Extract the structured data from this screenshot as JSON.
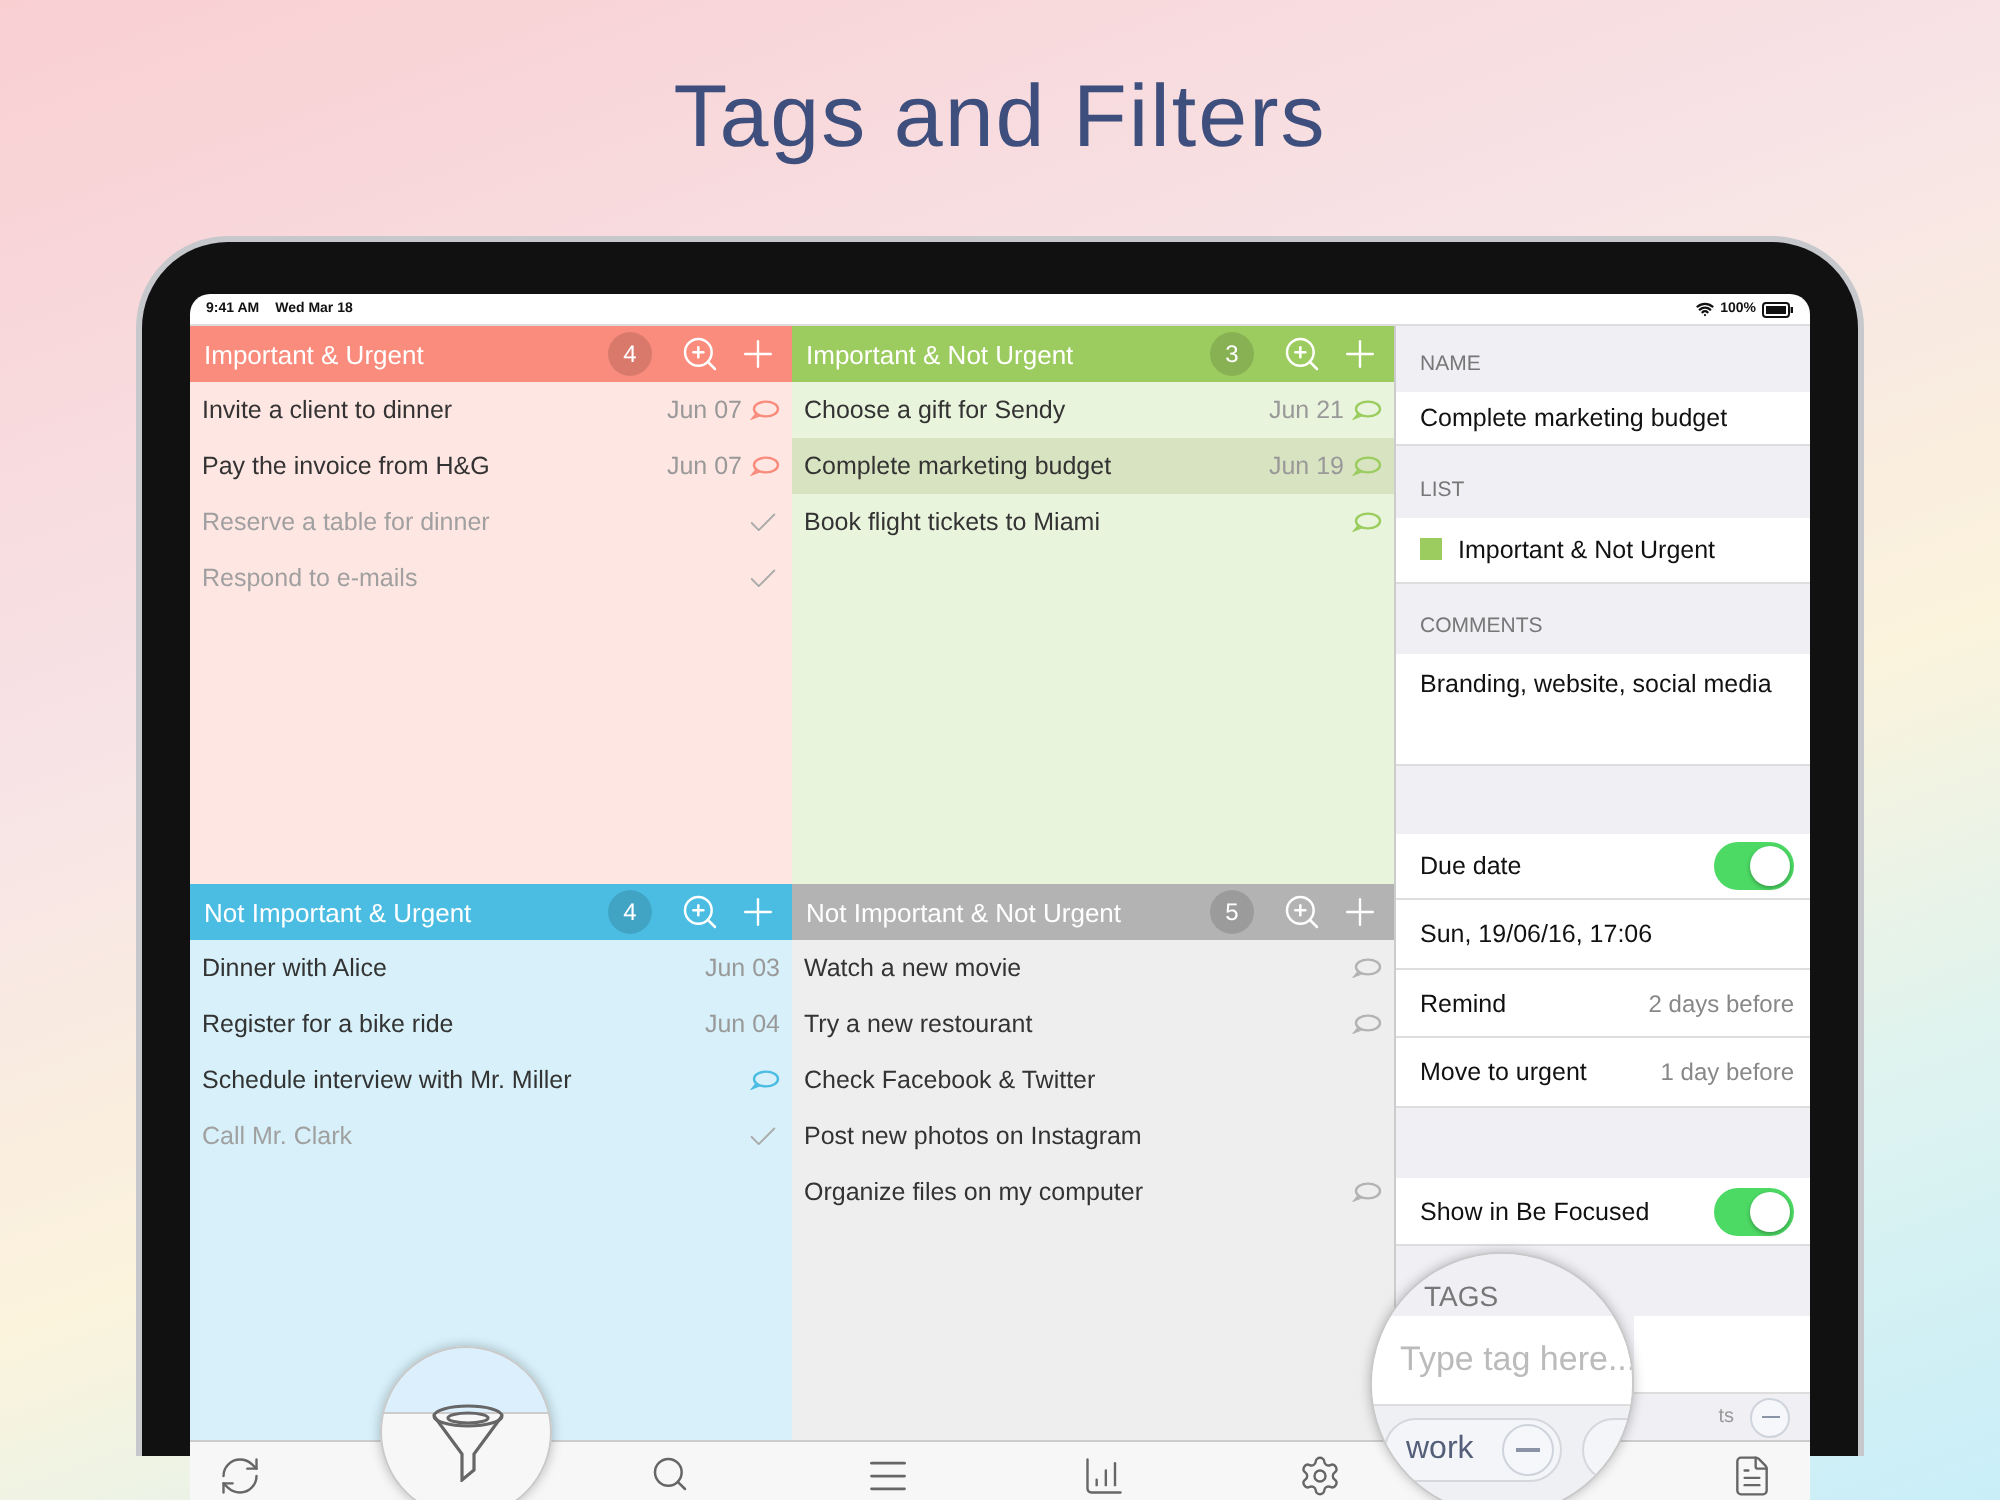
{
  "headline": "Tags and Filters",
  "status_bar": {
    "time": "9:41 AM",
    "date": "Wed Mar 18",
    "battery": "100%"
  },
  "quadrants": [
    {
      "title": "Important & Urgent",
      "count": "4",
      "color": "#fa8c7d",
      "tasks": [
        {
          "title": "Invite a client to dinner",
          "date": "Jun 07",
          "comment": true,
          "done": false,
          "selected": false
        },
        {
          "title": "Pay the invoice from H&G",
          "date": "Jun 07",
          "comment": true,
          "done": false,
          "selected": false
        },
        {
          "title": "Reserve a table for dinner",
          "comment": false,
          "done": true,
          "selected": false
        },
        {
          "title": "Respond to e-mails",
          "comment": false,
          "done": true,
          "selected": false
        }
      ]
    },
    {
      "title": "Important & Not Urgent",
      "count": "3",
      "color": "#9ccc5f",
      "tasks": [
        {
          "title": "Choose a gift for Sendy",
          "date": "Jun 21",
          "comment": true,
          "done": false,
          "selected": false
        },
        {
          "title": "Complete marketing budget",
          "date": "Jun 19",
          "comment": true,
          "done": false,
          "selected": true
        },
        {
          "title": "Book flight tickets to Miami",
          "comment": true,
          "done": false,
          "selected": false
        }
      ]
    },
    {
      "title": "Not Important & Urgent",
      "count": "4",
      "color": "#4bbde3",
      "tasks": [
        {
          "title": "Dinner with Alice",
          "date": "Jun 03",
          "comment": false,
          "done": false,
          "selected": false
        },
        {
          "title": "Register for a bike ride",
          "date": "Jun 04",
          "comment": false,
          "done": false,
          "selected": false
        },
        {
          "title": "Schedule interview with Mr. Miller",
          "comment": true,
          "done": false,
          "selected": false
        },
        {
          "title": "Call Mr. Clark",
          "comment": false,
          "done": true,
          "selected": false
        }
      ]
    },
    {
      "title": "Not Important & Not Urgent",
      "count": "5",
      "color": "#b3b3b3",
      "tasks": [
        {
          "title": "Watch a new movie",
          "comment": true,
          "done": false,
          "selected": false
        },
        {
          "title": "Try a new restourant",
          "comment": true,
          "done": false,
          "selected": false
        },
        {
          "title": "Check Facebook & Twitter",
          "comment": false,
          "done": false,
          "selected": false
        },
        {
          "title": "Post new photos on Instagram",
          "comment": false,
          "done": false,
          "selected": false
        },
        {
          "title": "Organize files on my computer",
          "comment": true,
          "done": false,
          "selected": false
        }
      ]
    }
  ],
  "detail": {
    "name_label": "NAME",
    "name": "Complete marketing budget",
    "list_label": "LIST",
    "list": {
      "name": "Important & Not Urgent",
      "color": "#9ccc5f"
    },
    "comments_label": "COMMENTS",
    "comments": "Branding, website, social media",
    "due_date": {
      "label": "Due date",
      "on": true
    },
    "due_value": "Sun, 19/06/16, 17:06",
    "remind": {
      "label": "Remind",
      "value": "2 days before"
    },
    "move": {
      "label": "Move to urgent",
      "value": "1 day before"
    },
    "focused": {
      "label": "Show in Be Focused",
      "on": true
    },
    "tags_label": "TAGS",
    "tag_input": {
      "placeholder": "Type tag here..."
    },
    "tags": [
      {
        "label": "work"
      },
      {
        "label": "ts"
      }
    ]
  }
}
